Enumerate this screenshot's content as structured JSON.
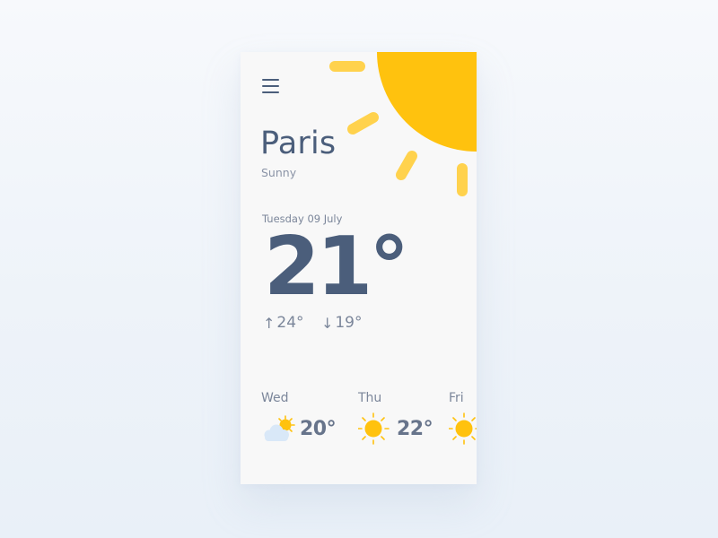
{
  "location": {
    "city": "Paris",
    "condition": "Sunny"
  },
  "today": {
    "date": "Tuesday 09 July",
    "temperature": "21°",
    "high": "24°",
    "low": "19°"
  },
  "icons": {
    "menu": "menu-icon",
    "header_art": "sun-icon",
    "high_arrow": "arrow-up-icon",
    "low_arrow": "arrow-down-icon"
  },
  "forecast": [
    {
      "day": "Wed",
      "temp": "20°",
      "icon": "partly-cloudy-icon"
    },
    {
      "day": "Thu",
      "temp": "22°",
      "icon": "sun-icon"
    },
    {
      "day": "Fri",
      "temp": "",
      "icon": "sun-icon"
    }
  ],
  "colors": {
    "sun": "#ffc20e",
    "sun_rays": "#ffd24d",
    "cloud": "#d9e8f8",
    "text_primary": "#4b5e7b",
    "text_secondary": "#7b869a"
  }
}
